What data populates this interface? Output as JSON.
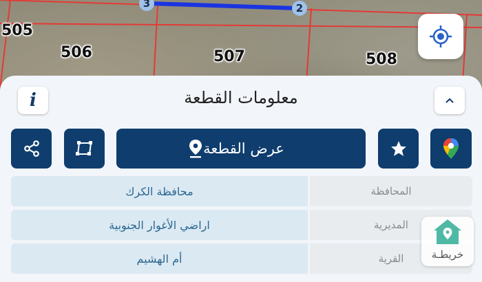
{
  "map": {
    "parcels": [
      {
        "label": "505"
      },
      {
        "label": "506"
      },
      {
        "label": "507"
      },
      {
        "label": "508"
      }
    ],
    "vertices": [
      {
        "label": "3"
      },
      {
        "label": "2"
      }
    ],
    "boundary_color": "#e53935",
    "selection_color": "#1a35e0"
  },
  "locate_icon": "crosshair-locate-icon",
  "sheet": {
    "title": "معلومات القطعة",
    "info_icon_letter": "i",
    "actions": {
      "view_parcel_label": "عرض القطعة",
      "google_maps_icon": "google-maps-pin-icon",
      "favorite_icon": "star-icon",
      "location_icon": "location-pin-icon",
      "shape_icon": "polygon-shape-icon",
      "share_icon": "share-icon"
    },
    "rows": [
      {
        "key": "المحافظة",
        "value": "محافظة الكرك"
      },
      {
        "key": "المديرية",
        "value": "اراضي الأغوار الجنوبية"
      },
      {
        "key": "القرية",
        "value": "أم الهشيم"
      }
    ]
  },
  "logo": {
    "text": "خريطـة",
    "color": "#4fb9a6"
  },
  "colors": {
    "primary": "#0f3d6e",
    "row_value_bg": "#dbe9f3",
    "row_value_text": "#2b6790",
    "row_key_bg": "#e9ecef"
  }
}
